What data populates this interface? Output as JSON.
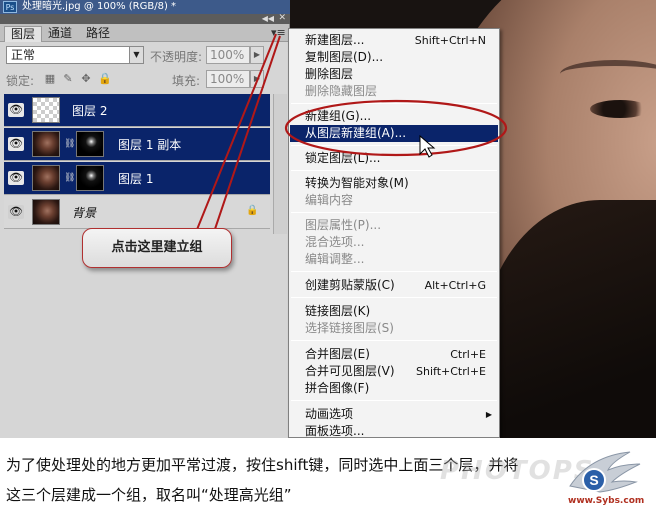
{
  "window": {
    "title": "处理暗光.jpg @ 100% (RGB/8) *",
    "app_icon": "Ps"
  },
  "layers_panel": {
    "tabs": [
      {
        "label": "图层"
      },
      {
        "label": "通道"
      },
      {
        "label": "路径"
      }
    ],
    "blend_mode": "正常",
    "opacity_label": "不透明度:",
    "opacity_value": "100%",
    "lock_label": "锁定:",
    "fill_label": "填充:",
    "fill_value": "100%",
    "layers": [
      {
        "name": "图层 2",
        "selected": true
      },
      {
        "name": "图层 1 副本",
        "selected": true
      },
      {
        "name": "图层 1",
        "selected": true
      },
      {
        "name": "背景",
        "selected": false
      }
    ]
  },
  "context_menu": {
    "items": [
      {
        "label": "新建图层...",
        "shortcut": "Shift+Ctrl+N"
      },
      {
        "label": "复制图层(D)..."
      },
      {
        "label": "删除图层"
      },
      {
        "label": "删除隐藏图层",
        "disabled": true
      },
      {
        "label": "新建组(G)..."
      },
      {
        "label": "从图层新建组(A)...",
        "highlight": true
      },
      {
        "label": "锁定图层(L)..."
      },
      {
        "label": "转换为智能对象(M)"
      },
      {
        "label": "编辑内容",
        "disabled": true
      },
      {
        "label": "图层属性(P)...",
        "disabled": true
      },
      {
        "label": "混合选项...",
        "disabled": true
      },
      {
        "label": "编辑调整...",
        "disabled": true
      },
      {
        "label": "创建剪贴蒙版(C)",
        "shortcut": "Alt+Ctrl+G"
      },
      {
        "label": "链接图层(K)"
      },
      {
        "label": "选择链接图层(S)",
        "disabled": true
      },
      {
        "label": "合并图层(E)",
        "shortcut": "Ctrl+E"
      },
      {
        "label": "合并可见图层(V)",
        "shortcut": "Shift+Ctrl+E"
      },
      {
        "label": "拼合图像(F)"
      },
      {
        "label": "动画选项"
      },
      {
        "label": "面板选项..."
      }
    ]
  },
  "callout": {
    "text": "点击这里建立组"
  },
  "caption": {
    "line1": "为了使处理处的地方更加平常过渡，按住shift键，同时选中上面三个层，并将",
    "line2": "这三个层建成一个组，取名叫“处理高光组”"
  },
  "watermark": {
    "text": "PHOTOPS",
    "site": "www.Sybs.com",
    "logo_text": "S"
  }
}
